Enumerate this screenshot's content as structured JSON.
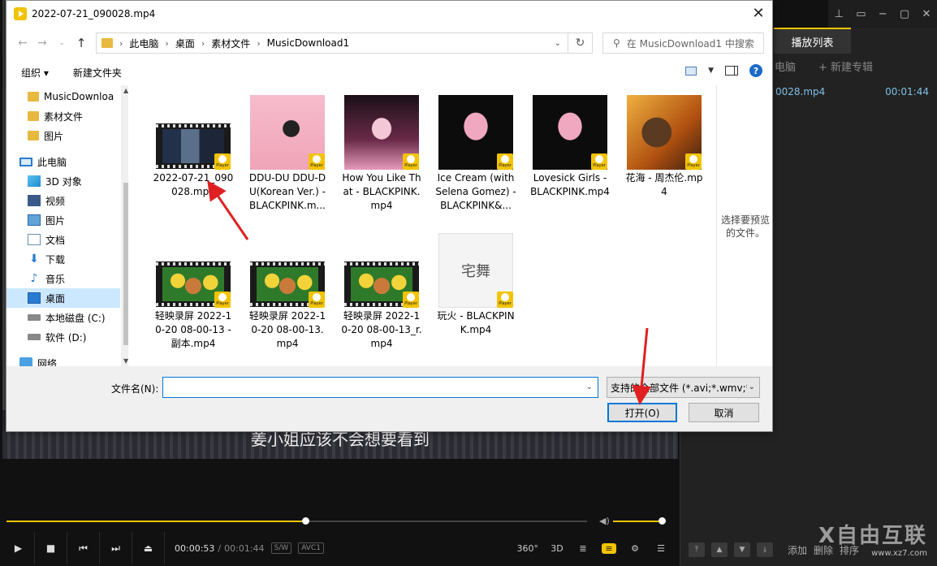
{
  "dialog": {
    "title": "2022-07-21_090028.mp4",
    "breadcrumbs": [
      "此电脑",
      "桌面",
      "素材文件",
      "MusicDownload1"
    ],
    "search_placeholder": "在 MusicDownload1 中搜索",
    "toolbar": {
      "organize": "组织 ▾",
      "new_folder": "新建文件夹"
    },
    "nav_items": [
      {
        "label": "MusicDownloa",
        "icon": "folder-icon"
      },
      {
        "label": "素材文件",
        "icon": "folder-icon"
      },
      {
        "label": "图片",
        "icon": "folder-icon"
      },
      {
        "label": "此电脑",
        "icon": "computer-icon"
      },
      {
        "label": "3D 对象",
        "icon": "3d-objects-icon"
      },
      {
        "label": "视频",
        "icon": "video-folder-icon"
      },
      {
        "label": "图片",
        "icon": "pictures-folder-icon"
      },
      {
        "label": "文档",
        "icon": "documents-folder-icon"
      },
      {
        "label": "下载",
        "icon": "download-arrow-icon"
      },
      {
        "label": "音乐",
        "icon": "music-note-icon"
      },
      {
        "label": "桌面",
        "icon": "desktop-icon"
      },
      {
        "label": "本地磁盘 (C:)",
        "icon": "drive-icon"
      },
      {
        "label": "软件 (D:)",
        "icon": "drive-icon"
      },
      {
        "label": "网络",
        "icon": "network-icon"
      }
    ],
    "files": [
      {
        "name": "2022-07-21_090028.mp4",
        "kind": "film",
        "art": "video-frame"
      },
      {
        "name": "DDU-DU DDU-DU(Korean Ver.) - BLACKPINK.m...",
        "kind": "cover",
        "art": "pink-cube"
      },
      {
        "name": "How You Like That - BLACKPINK.mp4",
        "kind": "cover",
        "art": "pink-wings"
      },
      {
        "name": "Ice Cream (with Selena Gomez) - BLACKPINK&...",
        "kind": "cover",
        "art": "crown"
      },
      {
        "name": "Lovesick Girls - BLACKPINK.mp4",
        "kind": "cover",
        "art": "crown"
      },
      {
        "name": "花海 - 周杰伦.mp4",
        "kind": "cover",
        "art": "fantasy"
      },
      {
        "name": "轻映录屏 2022-10-20 08-00-13 - 副本.mp4",
        "kind": "film",
        "art": "cartoon"
      },
      {
        "name": "轻映录屏 2022-10-20 08-00-13.mp4",
        "kind": "film",
        "art": "cartoon"
      },
      {
        "name": "轻映录屏 2022-10-20 08-00-13_r.mp4",
        "kind": "film",
        "art": "cartoon"
      },
      {
        "name": "玩火 - BLACKPINK.mp4",
        "kind": "cover",
        "art": "text-cover"
      }
    ],
    "badge_text": "Player",
    "text_cover_label": "宅舞",
    "preview_text": "选择要预览的文件。",
    "filename_label": "文件名(N):",
    "filename_value": "",
    "filetype_value": "支持的全部文件 (*.avi;*.wmv;*.",
    "open_label": "打开(O)",
    "cancel_label": "取消"
  },
  "player": {
    "subtitle": "姜小姐应该不会想要看到",
    "playlist_tab": "播放列表",
    "playlist_sub_left": "电脑",
    "playlist_sub_right": "+ 新建专辑",
    "playlist_item_name": "0028.mp4",
    "playlist_item_duration": "00:01:44",
    "time_current": "00:00:53",
    "time_total": "00:01:44",
    "tag_sw": "S/W",
    "tag_codec": "AVC1",
    "btn_360": "360°",
    "btn_3d": "3D",
    "bottom_add": "添加",
    "bottom_delete": "删除",
    "bottom_sort": "排序",
    "progress": 0.515,
    "volume": 1.0
  },
  "watermark": {
    "main": "X自由互联",
    "sub": "www.xz7.com"
  },
  "colors": {
    "accent": "#f2c300",
    "selection": "#cce8ff",
    "focus": "#0078d7",
    "annotation_red": "#e02020"
  }
}
